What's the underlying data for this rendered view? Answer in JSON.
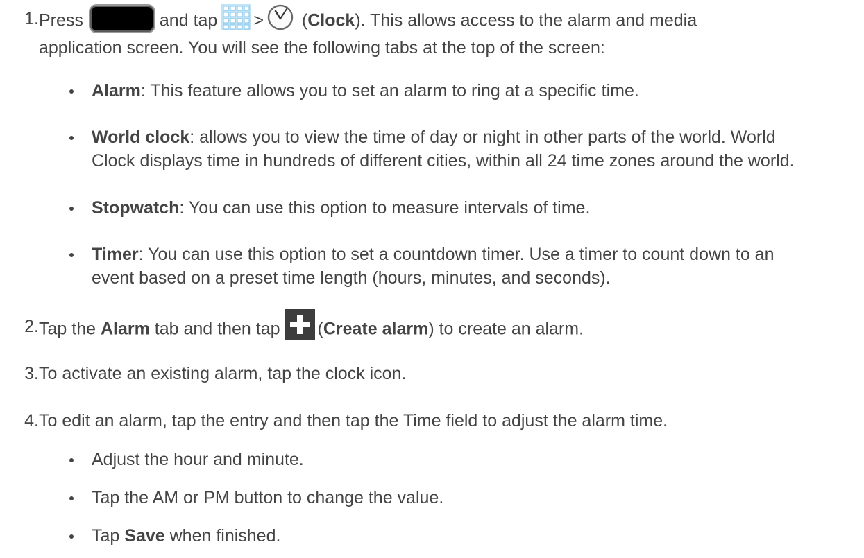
{
  "steps": [
    {
      "number": "1.",
      "part_press": "Press",
      "part_and_tap": "and tap",
      "part_gt": ">",
      "part_open": "(",
      "clock_label": "Clock",
      "line1_tail": "). This allows access to the alarm and media",
      "line2": "application screen. You will see the following tabs at the top of the screen:",
      "icons": [
        "home-key-icon",
        "apps-grid-icon",
        "clock-icon"
      ],
      "bullets": [
        {
          "term": "Alarm",
          "line1": ": This feature allows you to set an alarm to ring at a specific time."
        },
        {
          "term": "World clock",
          "line1": ": allows you to view the time of day or night in other parts of the world. World",
          "line2": "Clock displays time in hundreds of different cities, within all 24 time zones around the world."
        },
        {
          "term": "Stopwatch",
          "line1": ": You can use this option to measure intervals of time."
        },
        {
          "term": "Timer",
          "line1": ": You can use this option to set a countdown timer. Use a timer to count down to an",
          "line2": "event based on a preset time length (hours, minutes, and seconds)."
        }
      ]
    },
    {
      "number": "2.",
      "part_tap_the": "Tap the",
      "alarm_label": "Alarm",
      "part_tab_then": "tab and then tap",
      "part_open": "(",
      "create_label": "Create alarm",
      "tail": ") to create an alarm.",
      "icons": [
        "plus-icon"
      ]
    },
    {
      "number": "3.",
      "text": "To activate an existing alarm, tap the clock icon."
    },
    {
      "number": "4.",
      "text": "To edit an alarm, tap the entry and then tap the Time field to adjust the alarm time.",
      "bullets": [
        {
          "text": "Adjust the hour and minute."
        },
        {
          "text": "Tap the AM or PM button to change the value."
        },
        {
          "pre": "Tap",
          "term": "Save",
          "post": "when finished."
        }
      ]
    }
  ]
}
